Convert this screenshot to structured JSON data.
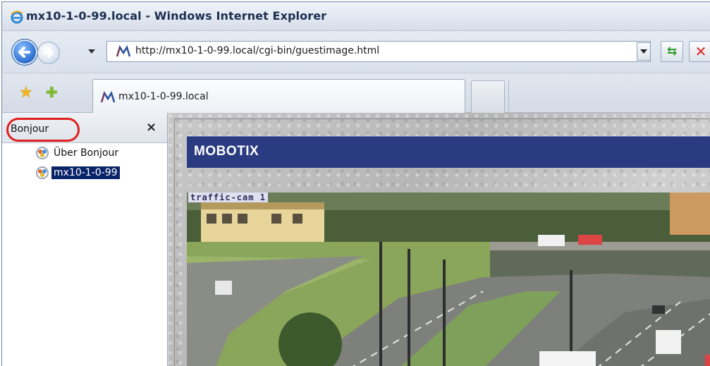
{
  "window": {
    "title": "mx10-1-0-99.local - Windows Internet Explorer"
  },
  "address_bar": {
    "url": "http://mx10-1-0-99.local/cgi-bin/guestimage.html"
  },
  "tabs": [
    {
      "label": "mx10-1-0-99.local",
      "active": true
    }
  ],
  "explorer_bar": {
    "title": "Bonjour",
    "close_symbol": "×",
    "items": [
      {
        "label": "Über Bonjour",
        "selected": false
      },
      {
        "label": "mx10-1-0-99",
        "selected": true
      }
    ]
  },
  "page": {
    "header_title": "MOBOTIX",
    "camera_overlay": "traffic-cam 1"
  },
  "icons": {
    "browser": "ie-logo-icon",
    "back": "back-arrow-icon",
    "forward": "forward-arrow-icon",
    "site": "mobotix-favicon-icon",
    "refresh": "refresh-icon",
    "stop": "stop-icon",
    "favorites": "favorites-star-icon",
    "add_favorite": "add-favorite-icon",
    "bonjour": "bonjour-icon"
  },
  "colors": {
    "mobotix_header": "#2b3b82",
    "selection": "#0a246a",
    "highlight_ring": "#e02020"
  }
}
